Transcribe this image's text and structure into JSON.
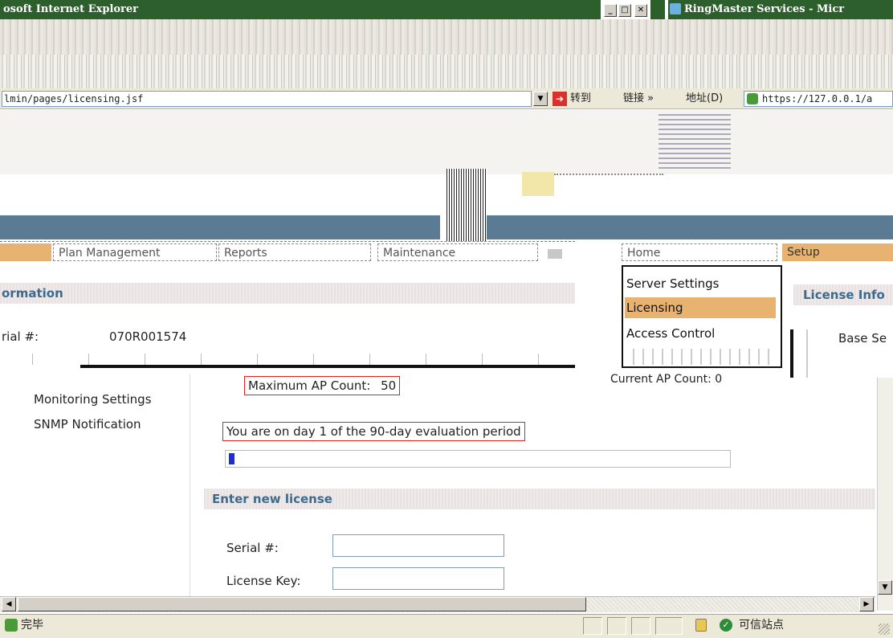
{
  "browser_left": {
    "title": "osoft Internet Explorer",
    "address_url": "lmin/pages/licensing.jsf",
    "go_label": "转到",
    "links_label": "链接 »"
  },
  "browser_right": {
    "title": "RingMaster Services - Micr",
    "address_label": "地址(D)",
    "address_url": "https://127.0.0.1/a"
  },
  "tabs": {
    "plan": "Plan Management",
    "reports": "Reports",
    "maintenance": "Maintenance",
    "home": "Home",
    "setup": "Setup"
  },
  "left_section": {
    "heading": "ormation",
    "serial_label": "rial #:",
    "serial_value": "070R001574"
  },
  "right_section": {
    "heading": "License Info",
    "base_label": "Base Se",
    "current_ap": "Current AP Count: 0"
  },
  "setup_menu": {
    "items": [
      "Server Settings",
      "Licensing",
      "Access Control"
    ],
    "active": "Licensing"
  },
  "sidebar": {
    "links": [
      "Monitoring Settings",
      "SNMP Notification"
    ]
  },
  "license": {
    "max_ap_label": "Maximum AP Count:",
    "max_ap_value": "50",
    "evaluation_text": "You are on day 1 of the 90-day evaluation period",
    "evaluation_progress": 0.011
  },
  "new_license": {
    "heading": "Enter new license",
    "serial_label": "Serial #:",
    "serial_value": "",
    "key_label": "License Key:",
    "key_value": ""
  },
  "statusbar": {
    "status_text": "完毕",
    "zone_text": "可信站点"
  }
}
